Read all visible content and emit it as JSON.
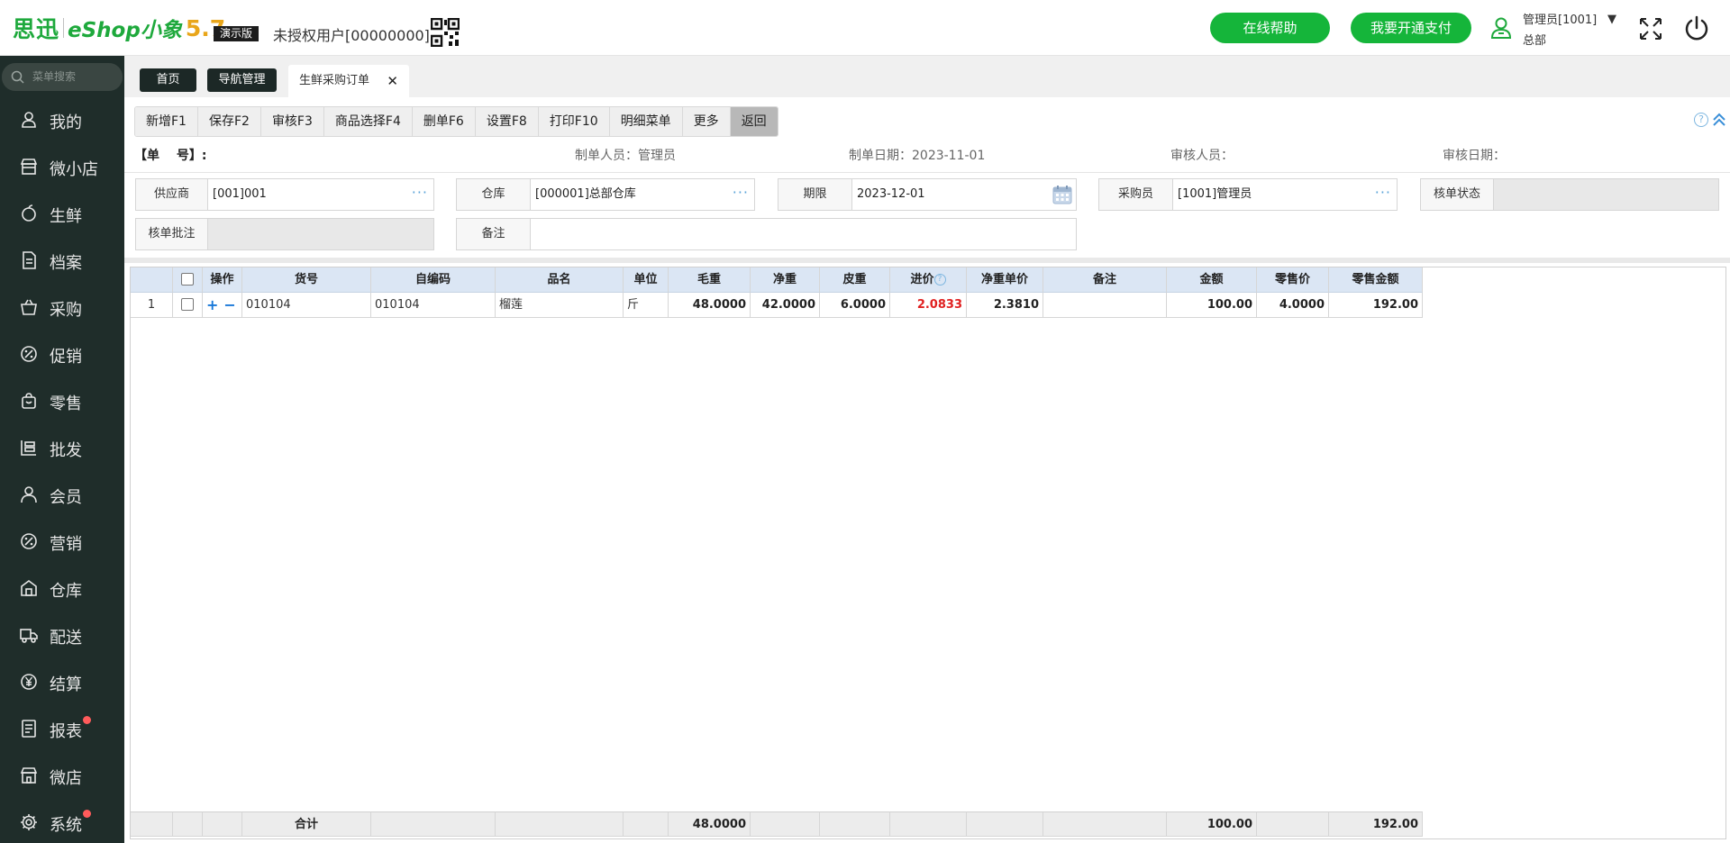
{
  "header": {
    "logo_cn": "思迅",
    "logo_e": "eShop小象",
    "logo_ver": "5.7",
    "demo_badge": "演示版",
    "user_tag": "未授权用户[00000000]",
    "help_label": "在线帮助",
    "pay_label": "我要开通支付",
    "admin_name": "管理员[1001]",
    "admin_dept": "总部",
    "accent": "#15b53a"
  },
  "sidebar": {
    "search_placeholder": "菜单搜索",
    "items": [
      {
        "label": "我的",
        "icon": "user-icon"
      },
      {
        "label": "微小店",
        "icon": "store-icon"
      },
      {
        "label": "生鲜",
        "icon": "apple-icon"
      },
      {
        "label": "档案",
        "icon": "document-icon"
      },
      {
        "label": "采购",
        "icon": "basket-icon"
      },
      {
        "label": "促销",
        "icon": "discount-icon"
      },
      {
        "label": "零售",
        "icon": "bag-icon"
      },
      {
        "label": "批发",
        "icon": "wholesale-icon"
      },
      {
        "label": "会员",
        "icon": "member-icon"
      },
      {
        "label": "营销",
        "icon": "marketing-icon"
      },
      {
        "label": "仓库",
        "icon": "warehouse-icon"
      },
      {
        "label": "配送",
        "icon": "truck-icon"
      },
      {
        "label": "结算",
        "icon": "yen-icon"
      },
      {
        "label": "报表",
        "icon": "report-icon",
        "badge": true
      },
      {
        "label": "微店",
        "icon": "shop-icon"
      },
      {
        "label": "系统",
        "icon": "gear-icon",
        "badge": true
      }
    ]
  },
  "tabs": {
    "home": "首页",
    "nav": "导航管理",
    "active": "生鲜采购订单",
    "close": "✕"
  },
  "toolbar": {
    "buttons": [
      "新增F1",
      "保存F2",
      "审核F3",
      "商品选择F4",
      "删单F6",
      "设置F8",
      "打印F10",
      "明细菜单",
      "更多"
    ],
    "back": "返回"
  },
  "info": {
    "order_no_label": "【单　 号】:",
    "creator": "制单人员：管理员",
    "create_date": "制单日期：2023-11-01",
    "auditor": "审核人员：",
    "audit_date": "审核日期："
  },
  "form": {
    "supplier": {
      "label": "供应商",
      "value": "[001]001"
    },
    "warehouse": {
      "label": "仓库",
      "value": "[000001]总部仓库"
    },
    "deadline": {
      "label": "期限",
      "value": "2023-12-01"
    },
    "buyer": {
      "label": "采购员",
      "value": "[1001]管理员"
    },
    "audit_status": {
      "label": "核单状态",
      "value": ""
    },
    "audit_note": {
      "label": "核单批注",
      "value": ""
    },
    "remark": {
      "label": "备注",
      "value": ""
    }
  },
  "grid": {
    "columns": [
      "",
      "",
      "操作",
      "货号",
      "自编码",
      "品名",
      "单位",
      "毛重",
      "净重",
      "皮重",
      "进价",
      "净重单价",
      "备注",
      "金额",
      "零售价",
      "零售金额"
    ],
    "rows": [
      {
        "no": "1",
        "code": "010104",
        "self_code": "010104",
        "name": "榴莲",
        "unit": "斤",
        "gross": "48.0000",
        "net": "42.0000",
        "tare": "6.0000",
        "price": "2.0833",
        "net_unit_price": "2.3810",
        "remark": "",
        "amount": "100.00",
        "retail_price": "4.0000",
        "retail_amount": "192.00"
      }
    ],
    "footer": {
      "label": "合计",
      "gross": "48.0000",
      "amount": "100.00",
      "retail_amount": "192.00"
    }
  }
}
